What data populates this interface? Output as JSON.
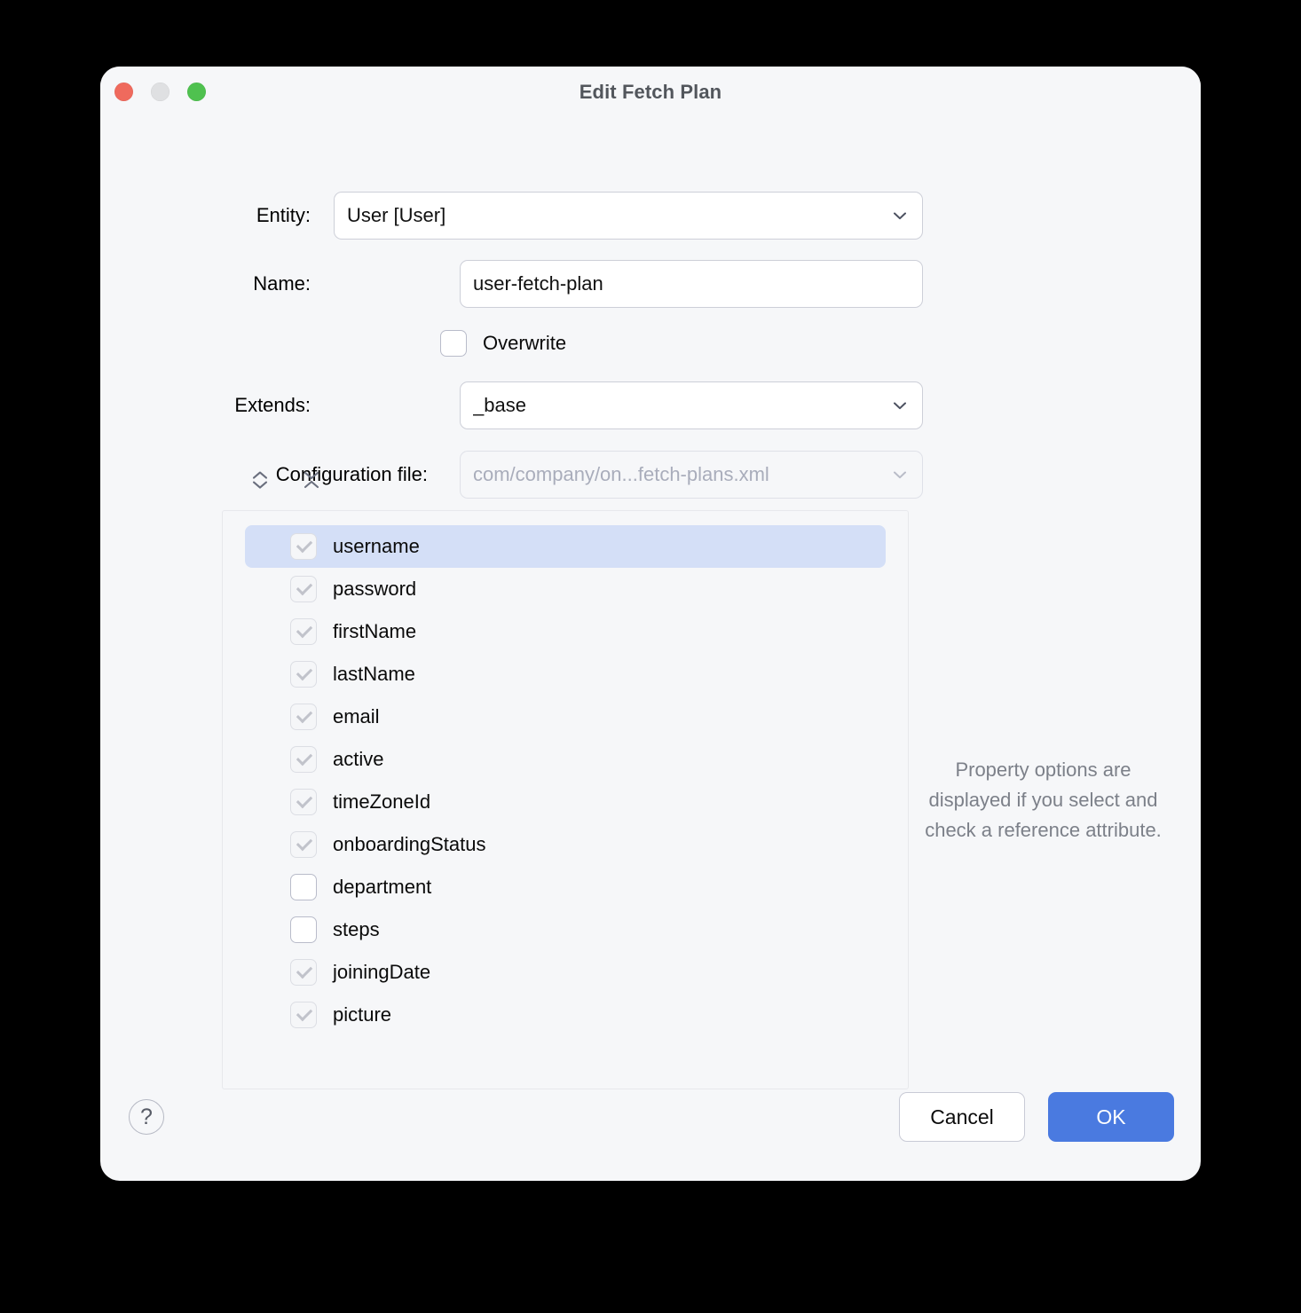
{
  "window": {
    "title": "Edit Fetch Plan",
    "traffic_lights": [
      "close-button",
      "minimize-button",
      "zoom-button"
    ]
  },
  "form": {
    "entity": {
      "label": "Entity:",
      "value": "User [User]",
      "icon": "chevron-down-icon"
    },
    "name": {
      "label": "Name:",
      "value": "user-fetch-plan",
      "placeholder": ""
    },
    "overwrite": {
      "label": "Overwrite",
      "checked": false
    },
    "extends": {
      "label": "Extends:",
      "value": "_base",
      "icon": "chevron-down-icon"
    },
    "configuration_file": {
      "label": "Configuration file:",
      "value": "com/company/on...fetch-plans.xml",
      "icon": "chevron-down-icon",
      "disabled": true
    }
  },
  "tree_toolbar": {
    "expand_all": "expand-all-icon",
    "collapse_all": "collapse-all-icon"
  },
  "attributes": [
    {
      "name": "username",
      "checked": true,
      "enabled": false,
      "selected": true
    },
    {
      "name": "password",
      "checked": true,
      "enabled": false,
      "selected": false
    },
    {
      "name": "firstName",
      "checked": true,
      "enabled": false,
      "selected": false
    },
    {
      "name": "lastName",
      "checked": true,
      "enabled": false,
      "selected": false
    },
    {
      "name": "email",
      "checked": true,
      "enabled": false,
      "selected": false
    },
    {
      "name": "active",
      "checked": true,
      "enabled": false,
      "selected": false
    },
    {
      "name": "timeZoneId",
      "checked": true,
      "enabled": false,
      "selected": false
    },
    {
      "name": "onboardingStatus",
      "checked": true,
      "enabled": false,
      "selected": false
    },
    {
      "name": "department",
      "checked": false,
      "enabled": true,
      "selected": false
    },
    {
      "name": "steps",
      "checked": false,
      "enabled": true,
      "selected": false
    },
    {
      "name": "joiningDate",
      "checked": true,
      "enabled": false,
      "selected": false
    },
    {
      "name": "picture",
      "checked": true,
      "enabled": false,
      "selected": false
    }
  ],
  "hint": {
    "text": "Property options are displayed if you select and check a reference attribute."
  },
  "footer": {
    "help_label": "?",
    "cancel_label": "Cancel",
    "ok_label": "OK"
  },
  "colors": {
    "accent": "#4a7ae0",
    "selection": "#d4dff7",
    "window_bg": "#f6f7f9",
    "title_text": "#52565c",
    "hint_text": "#7c8089",
    "close": "#ef6a5d",
    "minimize": "#dfe0e2",
    "zoom": "#4fc14f"
  }
}
